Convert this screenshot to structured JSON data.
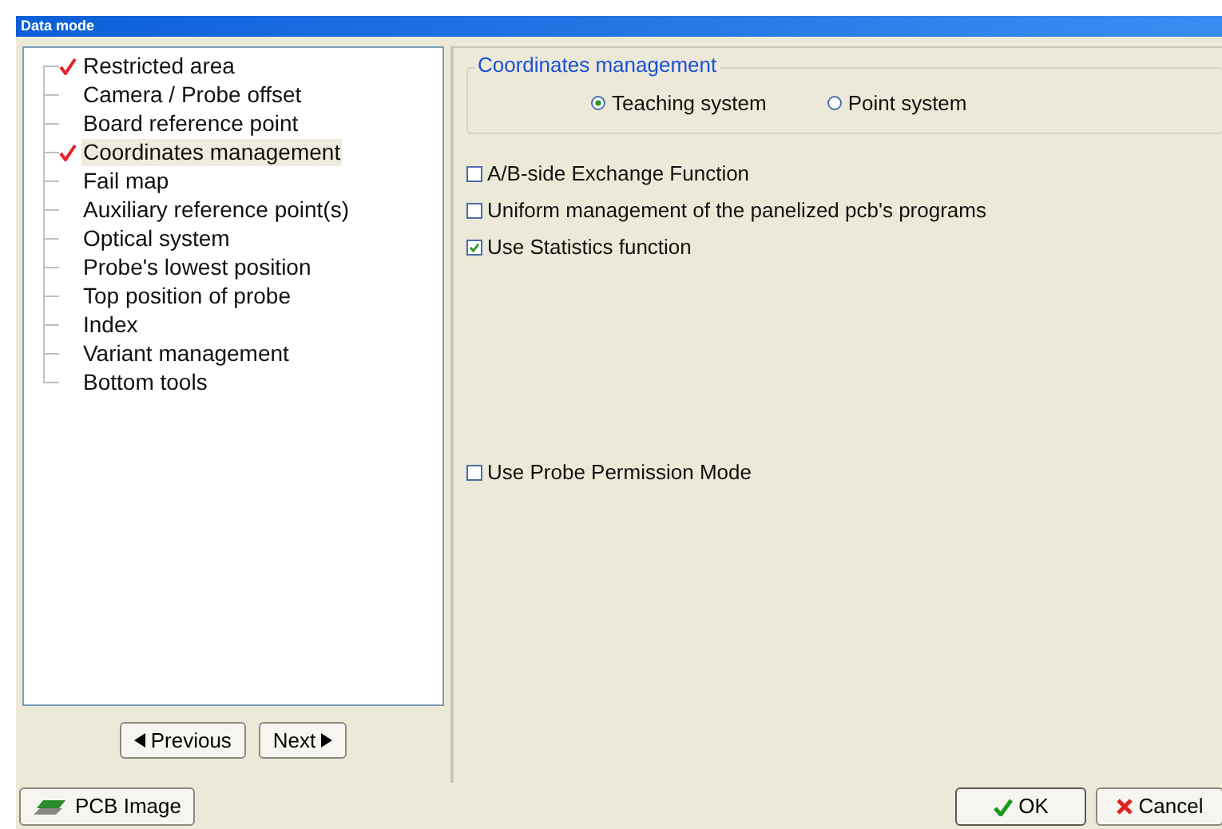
{
  "window": {
    "title": "Data mode"
  },
  "tree": {
    "items": [
      {
        "label": "Restricted area",
        "checked": true,
        "selected": false
      },
      {
        "label": "Camera / Probe offset",
        "checked": false,
        "selected": false
      },
      {
        "label": "Board reference point",
        "checked": false,
        "selected": false
      },
      {
        "label": "Coordinates management",
        "checked": true,
        "selected": true
      },
      {
        "label": "Fail map",
        "checked": false,
        "selected": false
      },
      {
        "label": "Auxiliary reference point(s)",
        "checked": false,
        "selected": false
      },
      {
        "label": "Optical system",
        "checked": false,
        "selected": false
      },
      {
        "label": "Probe's lowest position",
        "checked": false,
        "selected": false
      },
      {
        "label": "Top position of probe",
        "checked": false,
        "selected": false
      },
      {
        "label": "Index",
        "checked": false,
        "selected": false
      },
      {
        "label": "Variant management",
        "checked": false,
        "selected": false
      },
      {
        "label": "Bottom tools",
        "checked": false,
        "selected": false
      }
    ]
  },
  "nav_buttons": [
    "Previous",
    "Next"
  ],
  "group": {
    "title": "Coordinates management",
    "options": [
      {
        "label": "Teaching system",
        "selected": true
      },
      {
        "label": "Point system",
        "selected": false
      }
    ]
  },
  "checkboxes": [
    {
      "label": "A/B-side Exchange Function",
      "checked": false
    },
    {
      "label": "Uniform management of the panelized pcb's programs",
      "checked": false
    },
    {
      "label": "Use Statistics function",
      "checked": true
    }
  ],
  "checkboxes_lower": [
    {
      "label": "Use Probe Permission Mode",
      "checked": false
    }
  ],
  "footer": {
    "image_button": "PCB Image",
    "ok": "OK",
    "cancel": "Cancel"
  }
}
